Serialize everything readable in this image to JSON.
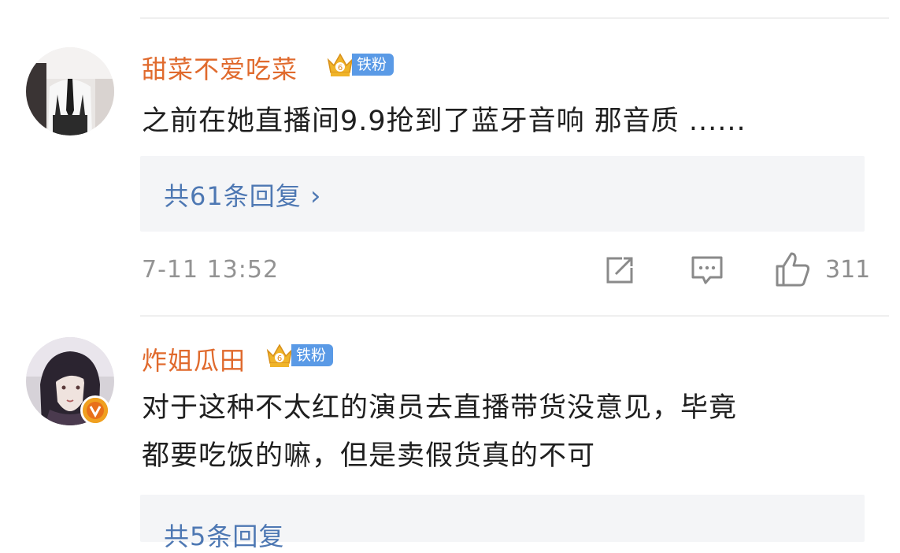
{
  "comments": [
    {
      "username": "甜菜不爱吃菜",
      "badge": "铁粉",
      "text": "之前在她直播间9.9抢到了蓝牙音响  那音质 ......",
      "replies_label": "共61条回复",
      "replies_arrow": "›",
      "time": "7-11 13:52",
      "likes": "311"
    },
    {
      "username": "炸姐瓜田",
      "badge": "铁粉",
      "text_line1": "对于这种不太红的演员去直播带货没意见，毕竟",
      "text_line2": "都要吃饭的嘛，但是卖假货真的不可",
      "replies_label": "共5条回复",
      "verified_mark": "v"
    }
  ],
  "colors": {
    "username": "#e06a2d",
    "reply_link": "#4e78b3",
    "badge_blue": "#5a9ae6",
    "crown_gold": "#f0b429",
    "meta_gray": "#939393"
  }
}
